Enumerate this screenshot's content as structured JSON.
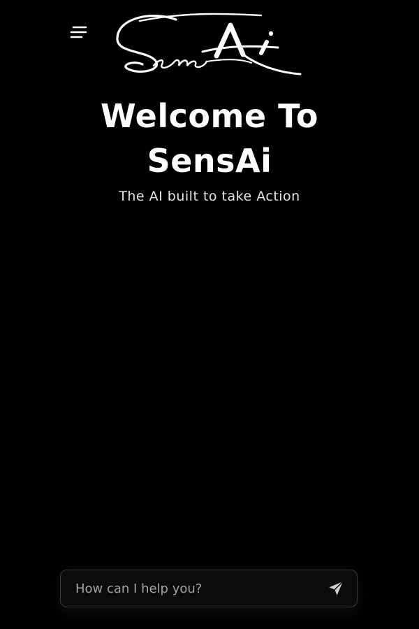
{
  "header": {
    "menu_icon": "hamburger-menu-icon",
    "logo": {
      "text": "SensAi",
      "style": "handwritten-signature"
    }
  },
  "hero": {
    "title_line1": "Welcome To",
    "title_line2": "SensAi",
    "tagline": "The AI built to take Action"
  },
  "chat": {
    "placeholder": "How can I help you?",
    "value": "",
    "send_icon": "send-paper-plane-icon"
  },
  "colors": {
    "background": "#000000",
    "text": "#ffffff",
    "input_border": "#3a3a3a",
    "placeholder": "#a3a3a3"
  }
}
